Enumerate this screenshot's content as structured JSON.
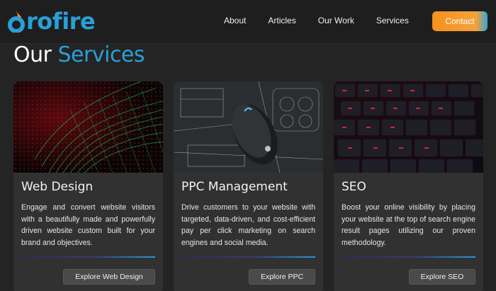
{
  "brand": {
    "logo_text": "rofire",
    "accent": "#2a9fd8",
    "flame_colors": [
      "#f6921e",
      "#2a9fd8"
    ]
  },
  "nav": {
    "links": [
      "About",
      "Articles",
      "Our Work",
      "Services"
    ],
    "contact_label": "Contact"
  },
  "heading": {
    "word1": "Our",
    "word2": "Services"
  },
  "cards": [
    {
      "image": "red-green-digital-network-wave",
      "title": "Web Design",
      "description": "Engage and convert website visitors with a beautifully made and powerfully driven website custom built for your brand and objectives.",
      "button": "Explore Web Design"
    },
    {
      "image": "computer-mouse-on-tech-blueprint",
      "title": "PPC Management",
      "description": "Drive customers to your website with targeted, data-driven, and cost-efficient pay per click marketing on search engines and social media.",
      "button": "Explore PPC"
    },
    {
      "image": "red-backlit-keyboard",
      "title": "SEO",
      "description": "Boost your online visibility by placing your website at the top of search engine result pages utilizing our proven methodology.",
      "button": "Explore SEO"
    }
  ]
}
